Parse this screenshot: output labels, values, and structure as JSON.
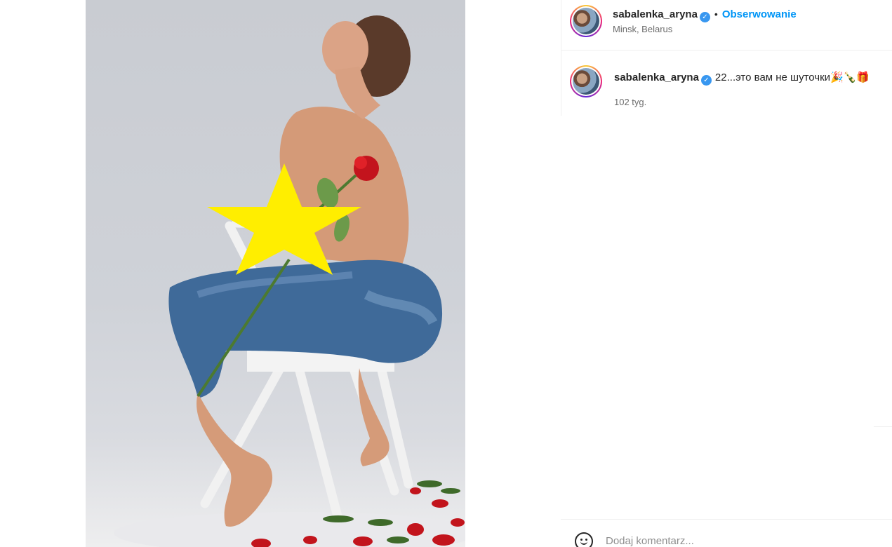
{
  "post": {
    "photo_alt": "",
    "censor_shape": "star",
    "censor_color": "#ffee00"
  },
  "header": {
    "username": "sabalenka_aryna",
    "verified_mark": "✓",
    "separator": "•",
    "follow_label": "Obserwowanie",
    "location": "Minsk, Belarus"
  },
  "caption": {
    "username": "sabalenka_aryna",
    "verified_mark": "✓",
    "text": "22...это вам не шуточки🎉🍾🎁",
    "time": "102 tyg."
  },
  "comment": {
    "placeholder": "Dodaj komentarz..."
  },
  "colors": {
    "link_blue": "#0095f6",
    "verified_blue": "#3897f0",
    "divider": "#efefef"
  }
}
